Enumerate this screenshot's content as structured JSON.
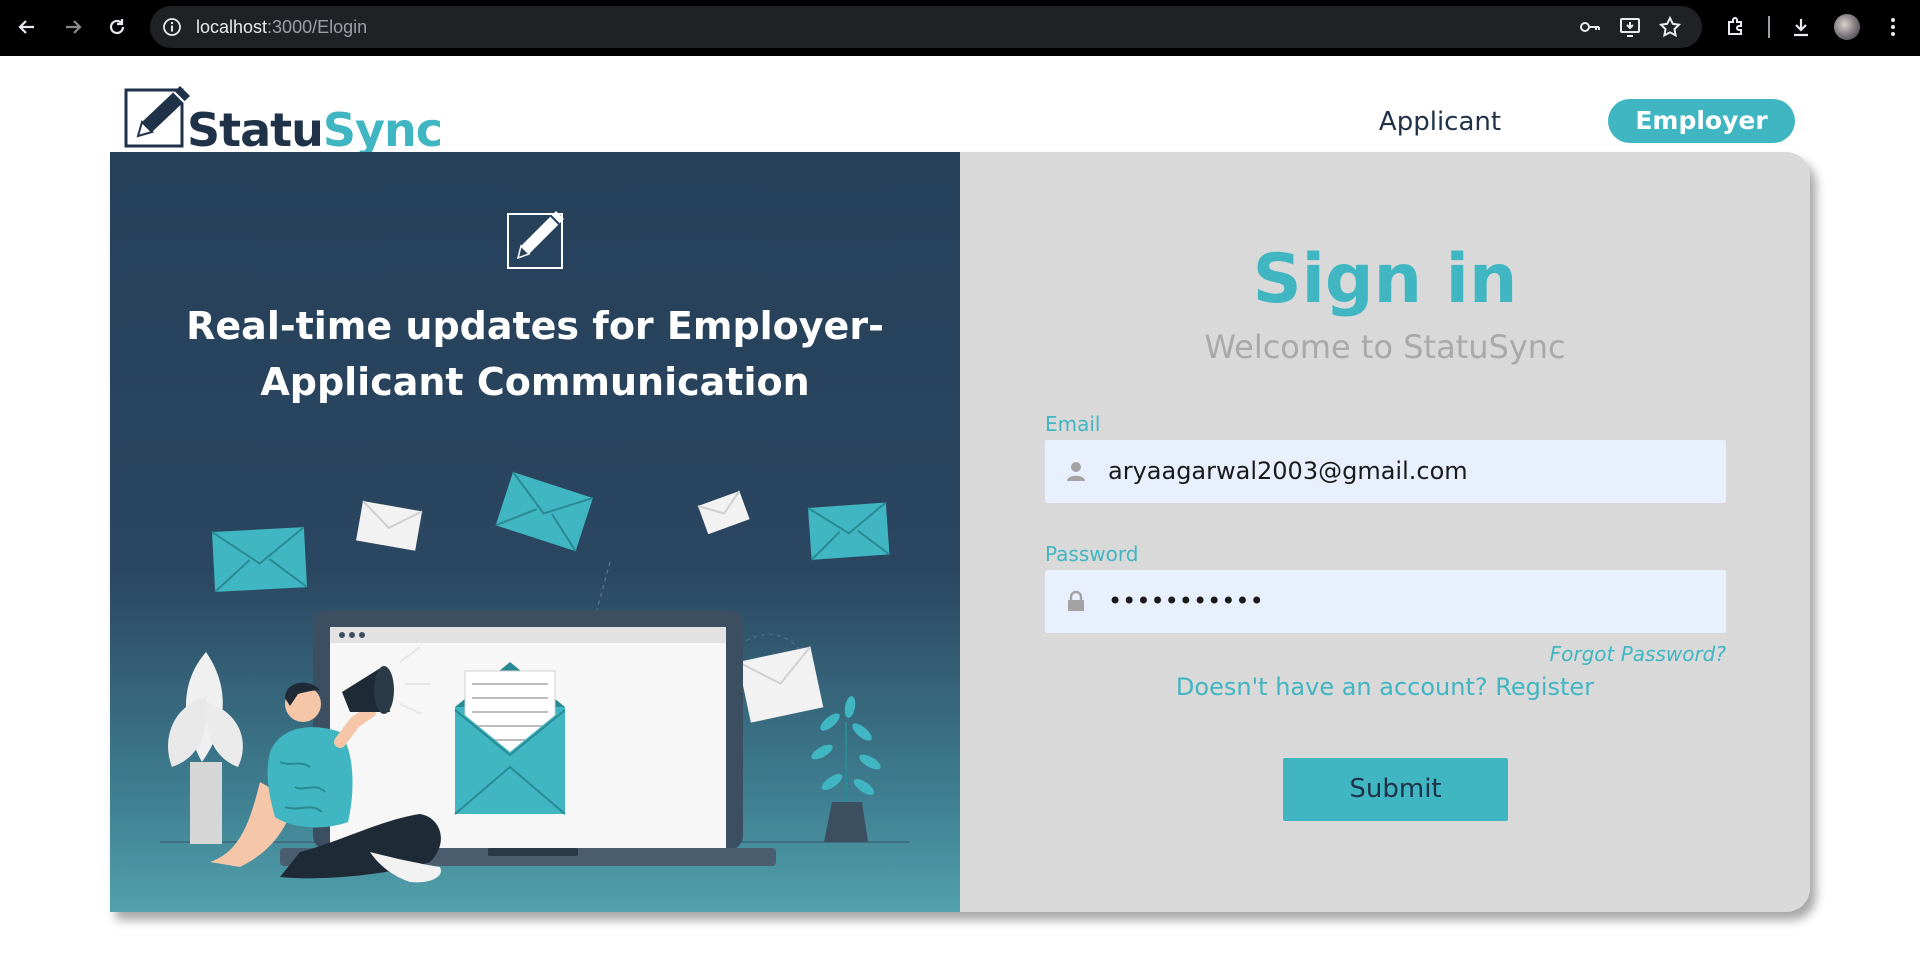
{
  "browser": {
    "url_host": "localhost",
    "url_path": ":3000/Elogin"
  },
  "header": {
    "logo_part1": "Statu",
    "logo_part2": "Sync",
    "nav_applicant": "Applicant",
    "nav_employer": "Employer"
  },
  "hero": {
    "tagline_line1": "Real-time updates for Employer-",
    "tagline_line2": "Applicant Communication"
  },
  "form": {
    "title": "Sign in",
    "subtitle": "Welcome to StatuSync",
    "email_label": "Email",
    "email_value": "aryaagarwal2003@gmail.com",
    "password_label": "Password",
    "password_value": "•••••••••••",
    "forgot": "Forgot Password?",
    "register": "Doesn't have an account? Register",
    "submit": "Submit"
  },
  "colors": {
    "accent": "#3fb6c1",
    "navy": "#1f3248",
    "panel": "#d9d9d9",
    "field_bg": "#e8f0fe"
  }
}
